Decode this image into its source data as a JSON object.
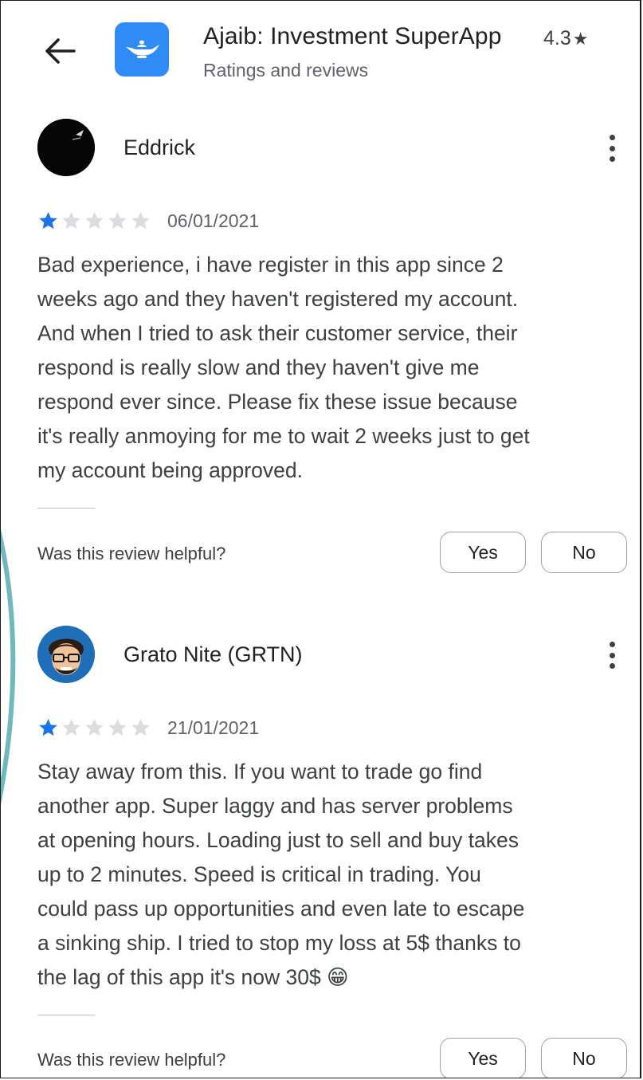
{
  "header": {
    "app_title": "Ajaib: Investment SuperApp",
    "rating": "4.3",
    "subtitle": "Ratings and reviews",
    "icons": {
      "back": "arrow-left-icon",
      "app": "genie-lamp-icon",
      "rating_star": "star-icon"
    }
  },
  "colors": {
    "app_icon_bg": "#2f8cf6",
    "star_filled": "#1a73e8",
    "star_empty": "#dadce0",
    "deco_teal": "#6fb9bd"
  },
  "reviews": [
    {
      "name": "Eddrick",
      "rating": 1,
      "max_rating": 5,
      "date": "06/01/2021",
      "text_lines": [
        "Bad experience, i have register in this app since 2",
        "weeks ago and they haven't registered my account.",
        "And when I tried to ask their customer service, their",
        "respond is really slow and they haven't give me",
        "respond ever since. Please fix these issue because",
        "it's really anmoying for me to wait 2 weeks just to get",
        "my account being approved."
      ],
      "helpful_label": "Was this review helpful?",
      "yes_label": "Yes",
      "no_label": "No"
    },
    {
      "name": "Grato Nite (GRTN)",
      "rating": 1,
      "max_rating": 5,
      "date": "21/01/2021",
      "text_lines": [
        "Stay away from this. If you want to trade go find",
        "another app. Super laggy and has server problems",
        "at opening hours. Loading just to sell and buy takes",
        "up to 2 minutes. Speed is critical in trading. You",
        "could pass up opportunities and even late to escape",
        "a sinking ship. I tried to stop my loss at 5$ thanks to",
        "the lag of this app it's now 30$ 😁"
      ],
      "helpful_label": "Was this review helpful?",
      "yes_label": "Yes",
      "no_label": "No"
    }
  ]
}
